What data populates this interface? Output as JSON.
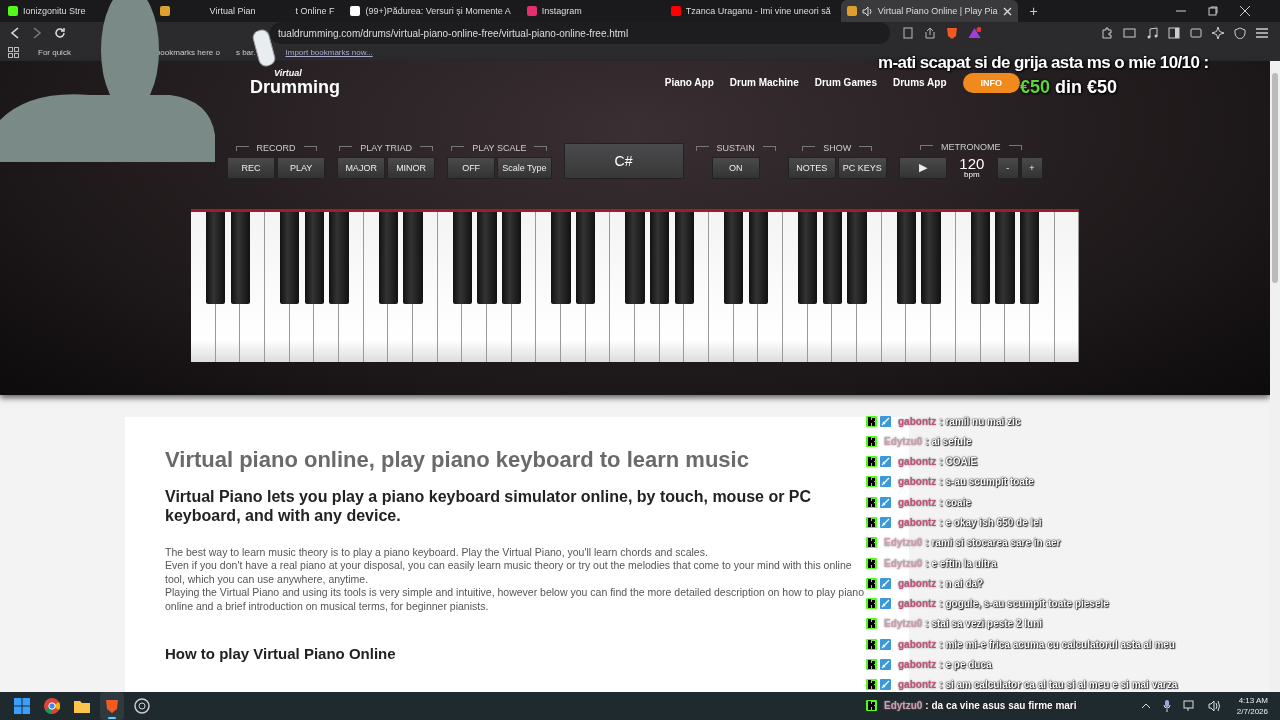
{
  "browser": {
    "tabs": [
      {
        "title": "Ionizgonitu Stre",
        "selected": false
      },
      {
        "title": "Virtual Pian",
        "title_end": "t Online F",
        "selected": false
      },
      {
        "title": "(99+)Pădurea: Versuri și Momente A",
        "selected": false
      },
      {
        "title": "Instagram",
        "selected": false
      },
      {
        "title": "Tzanca Uraganu - Imi vine uneori să",
        "selected": false
      },
      {
        "title": "Virtual Piano Online | Play Pia",
        "selected": true
      }
    ],
    "new_tab": "+",
    "url": "tualdrumming.com/drums/virtual-piano-online-free/virtual-piano-online-free.html",
    "bookmarks_bar": {
      "texts": [
        "For quick",
        "bookmarks here o",
        "s bar."
      ],
      "link": "Import bookmarks now..."
    }
  },
  "site": {
    "logo_top": "Virtual",
    "logo": "Drumming",
    "nav": [
      "Piano App",
      "Drum Machine",
      "Drum Games",
      "Drums App"
    ],
    "info_button": "INFO",
    "controls": [
      {
        "kind": "buttons",
        "label": "RECORD",
        "buttons": [
          "REC",
          "PLAY"
        ]
      },
      {
        "kind": "buttons",
        "label": "PLAY TRIAD",
        "buttons": [
          "MAJOR",
          "MINOR"
        ]
      },
      {
        "kind": "buttons",
        "label": "PLAY SCALE",
        "buttons": [
          "OFF",
          "Scale Type"
        ]
      },
      {
        "kind": "display",
        "value": "C#"
      },
      {
        "kind": "buttons",
        "label": "SUSTAIN",
        "buttons": [
          "ON"
        ]
      },
      {
        "kind": "buttons",
        "label": "SHOW",
        "buttons": [
          "NOTES",
          "PC KEYS"
        ]
      },
      {
        "kind": "metronome",
        "label": "METRONOME",
        "play": "▶",
        "value": "120",
        "unit": "bpm",
        "buttons": [
          "-",
          "+"
        ]
      }
    ],
    "article": {
      "title": "Virtual piano online, play piano keyboard to learn music",
      "subtitle": "Virtual Piano lets you play a piano keyboard simulator online, by touch, mouse or PC keyboard, and with any device.",
      "paragraphs": [
        "The best way to learn music theory is to play a piano keyboard. Play the Virtual Piano, you'll learn chords and scales.",
        "Even if you don't have a real piano at your disposal, you can easily learn music theory or try out the melodies that come to your mind with this online tool, which you can use anywhere, anytime.",
        "Playing the Virtual Piano and using its tools is very simple and intuitive, however below you can find the more detailed description on how to play piano online and a brief introduction on musical terms, for beginner pianists."
      ],
      "section_heading": "How to play Virtual Piano Online"
    }
  },
  "stream_overlay": {
    "donation": {
      "message": "m-ati scapat si de grija asta ms o mie 10/10 :",
      "amount": "€50",
      "goal": "din €50"
    },
    "chat": [
      {
        "kind": "badged",
        "author": "gabontz",
        "text": ": ramil nu mai zic",
        "color": "#c4507c"
      },
      {
        "kind": "plain",
        "author": "Edytzu0",
        "text": ": ai sefule",
        "color": "#d99bb4"
      },
      {
        "kind": "badged",
        "author": "gabontz",
        "text": ": COAIE",
        "color": "#c4507c"
      },
      {
        "kind": "badged",
        "author": "gabontz",
        "text": ": s-au scumpit toate",
        "color": "#c4507c"
      },
      {
        "kind": "badged",
        "author": "gabontz",
        "text": ": coaie",
        "color": "#c4507c"
      },
      {
        "kind": "badged",
        "author": "gabontz",
        "text": ": e okay ish 650 de lei",
        "color": "#c4507c"
      },
      {
        "kind": "plain",
        "author": "Edytzu0",
        "text": ": rami si stocarea sare in aer",
        "color": "#d99bb4"
      },
      {
        "kind": "plain",
        "author": "Edytzu0",
        "text": ": e eftin la ultra",
        "color": "#d99bb4"
      },
      {
        "kind": "badged",
        "author": "gabontz",
        "text": ": n ai da?",
        "color": "#c4507c"
      },
      {
        "kind": "badged",
        "author": "gabontz",
        "text": ": gogule, s-au scumpit toate piesele",
        "color": "#c4507c"
      },
      {
        "kind": "plain",
        "author": "Edytzu0",
        "text": ": stai sa vezi peste 2 luni",
        "color": "#d99bb4"
      },
      {
        "kind": "badged",
        "author": "gabontz",
        "text": ": mie mi-e frica acuma cu calculatorul asta al meu",
        "color": "#c4507c"
      },
      {
        "kind": "badged",
        "author": "gabontz",
        "text": ": e pe duca",
        "color": "#c4507c"
      },
      {
        "kind": "badged",
        "author": "gabontz",
        "text": ": si am calculator ca al tau si al meu e si mai varza",
        "color": "#c4507c"
      },
      {
        "kind": "plain",
        "author": "Edytzu0",
        "text": ": da ca vine asus sau firme mari",
        "color": "#d99bb4"
      }
    ]
  },
  "taskbar": {
    "apps": [
      {
        "selected": false
      },
      {
        "selected": false
      },
      {
        "selected": false
      },
      {
        "selected": true
      },
      {
        "selected": false
      }
    ],
    "time": "4:13 AM",
    "date": "2/7/2026"
  }
}
